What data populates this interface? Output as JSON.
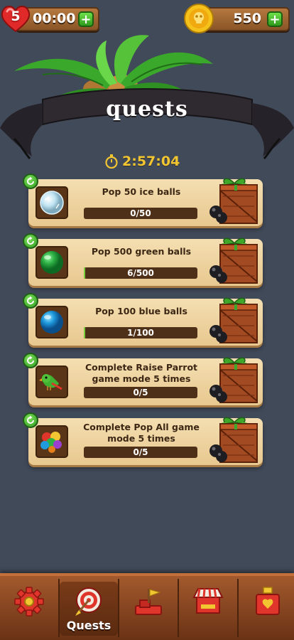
{
  "header": {
    "lives": "5",
    "timer": "00:00",
    "coins": "550"
  },
  "banner": {
    "title": "quests",
    "countdown": "2:57:04"
  },
  "quests": [
    {
      "title": "Pop 50 ice balls",
      "progress_text": "0/50",
      "progress": 0.0,
      "icon": "ice-ball-icon"
    },
    {
      "title": "Pop 500 green balls",
      "progress_text": "6/500",
      "progress": 0.012,
      "icon": "green-ball-icon"
    },
    {
      "title": "Pop 100 blue balls",
      "progress_text": "1/100",
      "progress": 0.01,
      "icon": "blue-ball-icon"
    },
    {
      "title": "Complete Raise Parrot game mode 5 times",
      "progress_text": "0/5",
      "progress": 0.0,
      "icon": "parrot-icon"
    },
    {
      "title": "Complete Pop All game mode 5 times",
      "progress_text": "0/5",
      "progress": 0.0,
      "icon": "balloons-icon"
    }
  ],
  "nav": {
    "items": [
      {
        "icon": "gear-icon",
        "label": ""
      },
      {
        "icon": "target-icon",
        "label": "Quests"
      },
      {
        "icon": "flag-icon",
        "label": ""
      },
      {
        "icon": "shop-icon",
        "label": ""
      },
      {
        "icon": "potion-icon",
        "label": ""
      }
    ]
  }
}
